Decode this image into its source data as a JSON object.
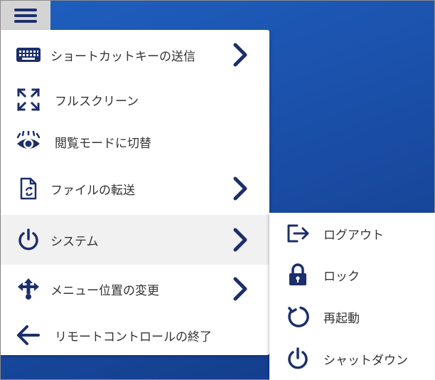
{
  "colors": {
    "accent": "#1c2f6b",
    "desktop": "#1a4fa8",
    "active_row": "#f1f1f1"
  },
  "toolbar": {
    "menu_icon": "hamburger-icon"
  },
  "menu": {
    "items": [
      {
        "label": "ショートカットキーの送信",
        "icon": "keyboard-icon",
        "has_submenu": true
      },
      {
        "label": "フルスクリーン",
        "icon": "fullscreen-icon",
        "has_submenu": false
      },
      {
        "label": "閲覧モードに切替",
        "icon": "eye-icon",
        "has_submenu": false
      },
      {
        "label": "ファイルの転送",
        "icon": "file-transfer-icon",
        "has_submenu": true
      },
      {
        "label": "システム",
        "icon": "power-icon",
        "has_submenu": true,
        "active": true
      },
      {
        "label": "メニュー位置の変更",
        "icon": "move-icon",
        "has_submenu": true
      },
      {
        "label": "リモートコントロールの終了",
        "icon": "arrow-left-icon",
        "has_submenu": false
      }
    ]
  },
  "submenu": {
    "items": [
      {
        "label": "ログアウト",
        "icon": "logout-icon"
      },
      {
        "label": "ロック",
        "icon": "lock-icon"
      },
      {
        "label": "再起動",
        "icon": "restart-icon"
      },
      {
        "label": "シャットダウン",
        "icon": "shutdown-icon"
      }
    ]
  }
}
